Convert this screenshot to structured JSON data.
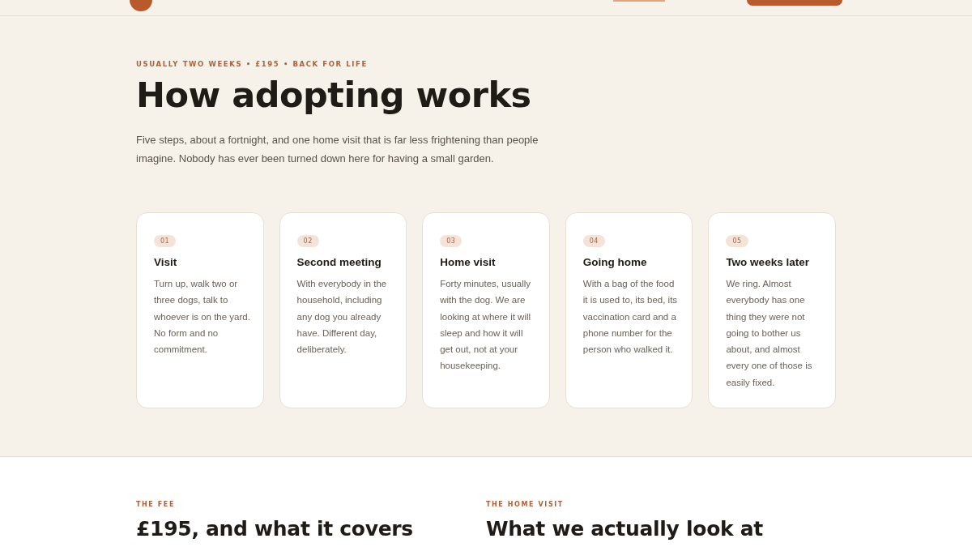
{
  "hero": {
    "eyebrow": "USUALLY TWO WEEKS • £195 • BACK FOR LIFE",
    "title": "How adopting works",
    "intro": "Five steps, about a fortnight, and one home visit that is far less frightening than people imagine. Nobody has ever been turned down here for having a small garden."
  },
  "steps": [
    {
      "number": "01",
      "title": "Visit",
      "text": "Turn up, walk two or three dogs, talk to whoever is on the yard. No form and no commitment."
    },
    {
      "number": "02",
      "title": "Second meeting",
      "text": "With everybody in the household, including any dog you already have. Different day, deliberately."
    },
    {
      "number": "03",
      "title": "Home visit",
      "text": "Forty minutes, usually with the dog. We are looking at where it will sleep and how it will get out, not at your housekeeping."
    },
    {
      "number": "04",
      "title": "Going home",
      "text": "With a bag of the food it is used to, its bed, its vaccination card and a phone number for the person who walked it."
    },
    {
      "number": "05",
      "title": "Two weeks later",
      "text": "We ring. Almost everybody has one thing they were not going to bother us about, and almost every one of those is easily fixed."
    }
  ],
  "sections": [
    {
      "eyebrow": "THE FEE",
      "title": "£195, and what it covers"
    },
    {
      "eyebrow": "THE HOME VISIT",
      "title": "What we actually look at"
    }
  ]
}
